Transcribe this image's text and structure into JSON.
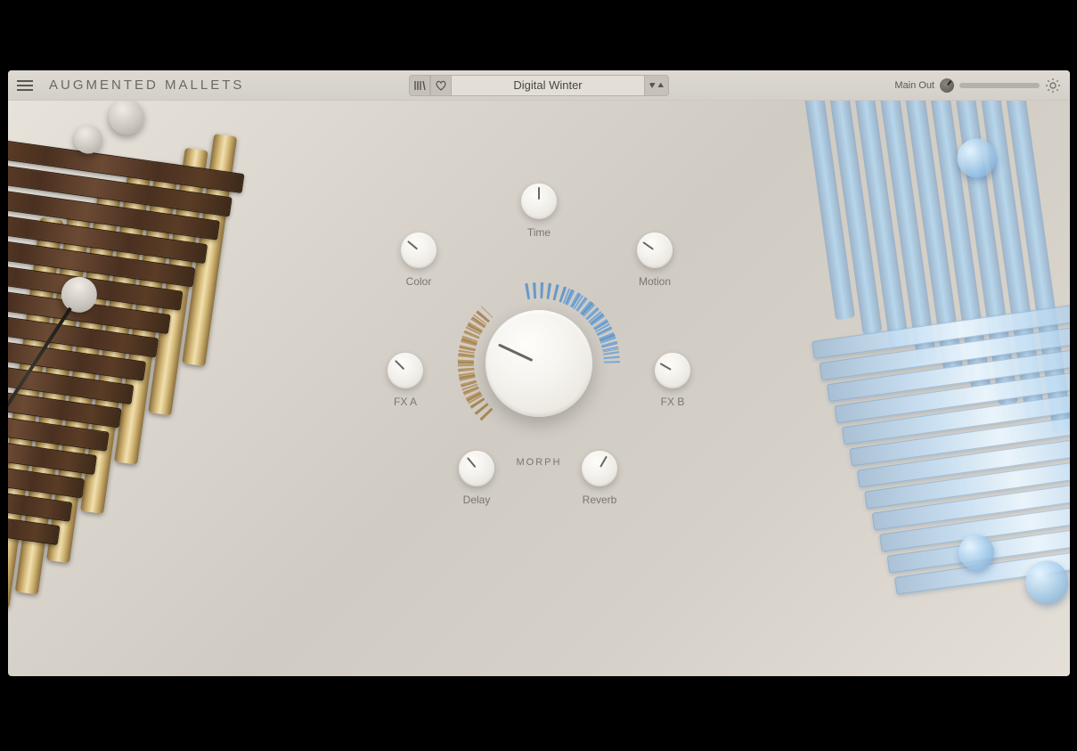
{
  "header": {
    "title": "AUGMENTED MALLETS",
    "preset_name": "Digital Winter",
    "main_out_label": "Main Out"
  },
  "knobs": {
    "time": {
      "label": "Time",
      "angle": 0
    },
    "color": {
      "label": "Color",
      "angle": -50
    },
    "motion": {
      "label": "Motion",
      "angle": -55
    },
    "fx_a": {
      "label": "FX A",
      "angle": -45
    },
    "fx_b": {
      "label": "FX B",
      "angle": -60
    },
    "delay": {
      "label": "Delay",
      "angle": -40
    },
    "reverb": {
      "label": "Reverb",
      "angle": 30
    },
    "morph_label": "MORPH"
  }
}
